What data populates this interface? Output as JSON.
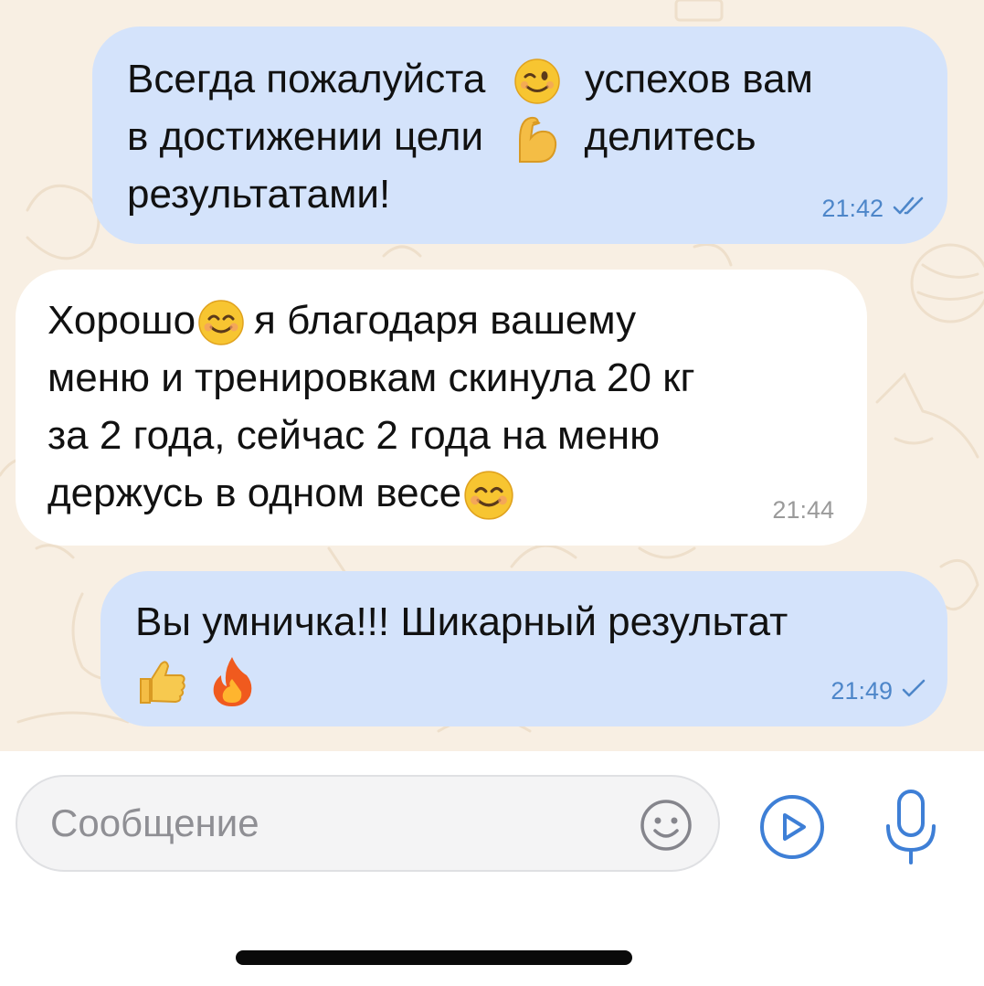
{
  "messages": [
    {
      "direction": "outgoing",
      "lines": [
        "Всегда пожалуйста",
        "успехов вам",
        "в достижении цели",
        "делитесь",
        "результатами!"
      ],
      "emojis": [
        "winking-face-emoji",
        "flexed-biceps-emoji"
      ],
      "time": "21:42",
      "status_icon": "double-check-icon"
    },
    {
      "direction": "incoming",
      "lines": [
        "Хорошо",
        "я благодаря вашему",
        "меню и тренировкам скинула 20 кг",
        "за 2 года, сейчас 2 года на меню",
        "держусь в одном весе"
      ],
      "emojis": [
        "smiling-face-emoji",
        "smiling-face-emoji"
      ],
      "time": "21:44"
    },
    {
      "direction": "outgoing",
      "lines": [
        "Вы умничка!!! Шикарный результат"
      ],
      "emojis": [
        "thumbs-up-emoji",
        "fire-emoji"
      ],
      "time": "21:49",
      "status_icon": "single-check-icon"
    }
  ],
  "input": {
    "placeholder": "Сообщение",
    "emoji_icon": "smiley-icon",
    "video_icon": "video-message-icon",
    "mic_icon": "microphone-icon"
  },
  "colors": {
    "chat_background": "#f8efe3",
    "outgoing_bubble": "#d4e3fb",
    "incoming_bubble": "#ffffff",
    "accent": "#3e7fd6"
  }
}
